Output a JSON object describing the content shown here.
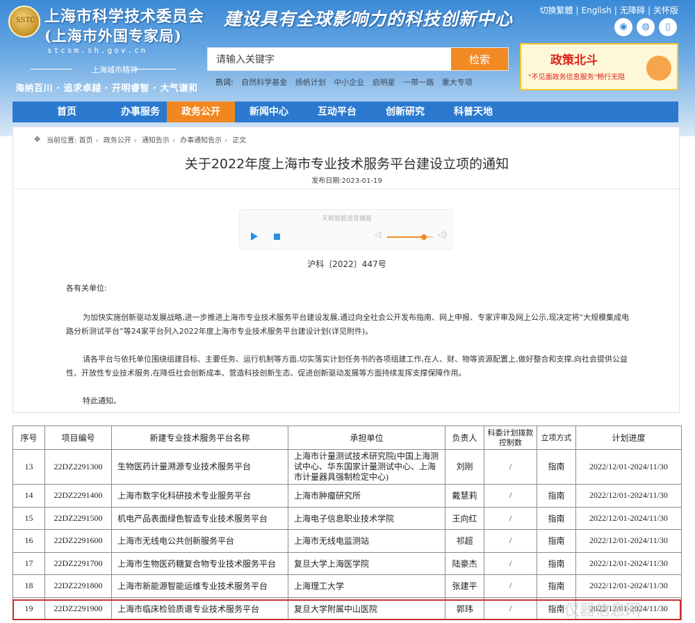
{
  "header": {
    "emblem_text": "SSTC",
    "org_name": "上海市科学技术委员会",
    "org_sub": "(上海市外国专家局)",
    "domain": "stcsm.sh.gov.cn",
    "slogan": "建设具有全球影响力的科技创新中心",
    "spirit_title": "上海城市精神",
    "spirit_text": "海纳百川 · 追求卓越 · 开明睿智 · 大气谦和",
    "top_links": [
      "切换繁體",
      "English",
      "无障碍",
      "关怀版"
    ],
    "social_icons": [
      "weibo-icon",
      "wechat-icon",
      "mobile-icon"
    ]
  },
  "search": {
    "placeholder": "请输入关键字",
    "button": "检索",
    "hot_label": "热词:",
    "hot_words": [
      "自然科学基金",
      "扬帆计划",
      "中小企业",
      "启明星",
      "一带一路",
      "重大专项"
    ]
  },
  "banner": {
    "title": "政策北斗",
    "subtitle": "\"不见面政务信息服务\"畅行无阻"
  },
  "nav": {
    "items": [
      "首页",
      "办事服务",
      "政务公开",
      "新闻中心",
      "互动平台",
      "创新研究",
      "科普天地"
    ],
    "active_index": 2
  },
  "breadcrumb": {
    "label": "当前位置:",
    "items": [
      "首页",
      "政务公开",
      "通知告示",
      "办事通知告示",
      "正文"
    ]
  },
  "article": {
    "title": "关于2022年度上海市专业技术服务平台建设立项的通知",
    "pubdate": "发布日期:2023-01-19",
    "doc_number": "沪科〔2022〕447号",
    "addressee": "各有关单位:",
    "paragraph1": "为加快实施创新驱动发展战略,进一步推进上海市专业技术服务平台建设发展,通过向全社会公开发布指南、网上申报、专家评审及网上公示,现决定将“大规模集成电路分析测试平台”等24家平台列入2022年度上海市专业技术服务平台建设计划(详见附件)。",
    "paragraph2": "请各平台与依托单位围绕组建目标、主要任务、运行机制等方面,切实落实计划任务书的各项组建工作,在人、财、物等资源配置上,做好整合和支撑,向社会提供公益性、开放性专业技术服务,在降低社会创新成本、营造科技创新生态、促进创新驱动发展等方面持续发挥支撑保障作用。",
    "closing": "特此通知。"
  },
  "audio": {
    "title": "天聪智能语音播报",
    "volume": 0.8
  },
  "table": {
    "headers": [
      "序号",
      "项目编号",
      "新建专业技术服务平台名称",
      "承担单位",
      "负责人",
      "科委计划拨款控制数",
      "立项方式",
      "计划进度"
    ],
    "rows": [
      [
        "13",
        "22DZ2291300",
        "生物医药计量溯源专业技术服务平台",
        "上海市计量测试技术研究院(中国上海测试中心、华东国家计量测试中心、上海市计量器具强制检定中心)",
        "刘刚",
        "/",
        "指南",
        "2022/12/01-2024/11/30"
      ],
      [
        "14",
        "22DZ2291400",
        "上海市数字化科研技术专业服务平台",
        "上海市肿瘤研究所",
        "戴慧莉",
        "/",
        "指南",
        "2022/12/01-2024/11/30"
      ],
      [
        "15",
        "22DZ2291500",
        "机电产品表面绿色智造专业技术服务平台",
        "上海电子信息职业技术学院",
        "王向红",
        "/",
        "指南",
        "2022/12/01-2024/11/30"
      ],
      [
        "16",
        "22DZ2291600",
        "上海市无线电公共创新服务平台",
        "上海市无线电监测站",
        "祁超",
        "/",
        "指南",
        "2022/12/01-2024/11/30"
      ],
      [
        "17",
        "22DZ2291700",
        "上海市生物医药糖复合物专业技术服务平台",
        "复旦大学上海医学院",
        "陆豪杰",
        "/",
        "指南",
        "2022/12/01-2024/11/30"
      ],
      [
        "18",
        "22DZ2291800",
        "上海市新能源智能运维专业技术服务平台",
        "上海理工大学",
        "张建平",
        "/",
        "指南",
        "2022/12/01-2024/11/30"
      ],
      [
        "19",
        "22DZ2291900",
        "上海市临床检验质谱专业技术服务平台",
        "复旦大学附属中山医院",
        "郭玮",
        "/",
        "指南",
        "2022/12/01-2024/11/30"
      ]
    ]
  },
  "watermark": "仪器信息网",
  "colors": {
    "nav_bg": "#2a79cf",
    "nav_active": "#f2871f",
    "search_button": "#f28a24",
    "highlight": "#cc2b2b"
  }
}
